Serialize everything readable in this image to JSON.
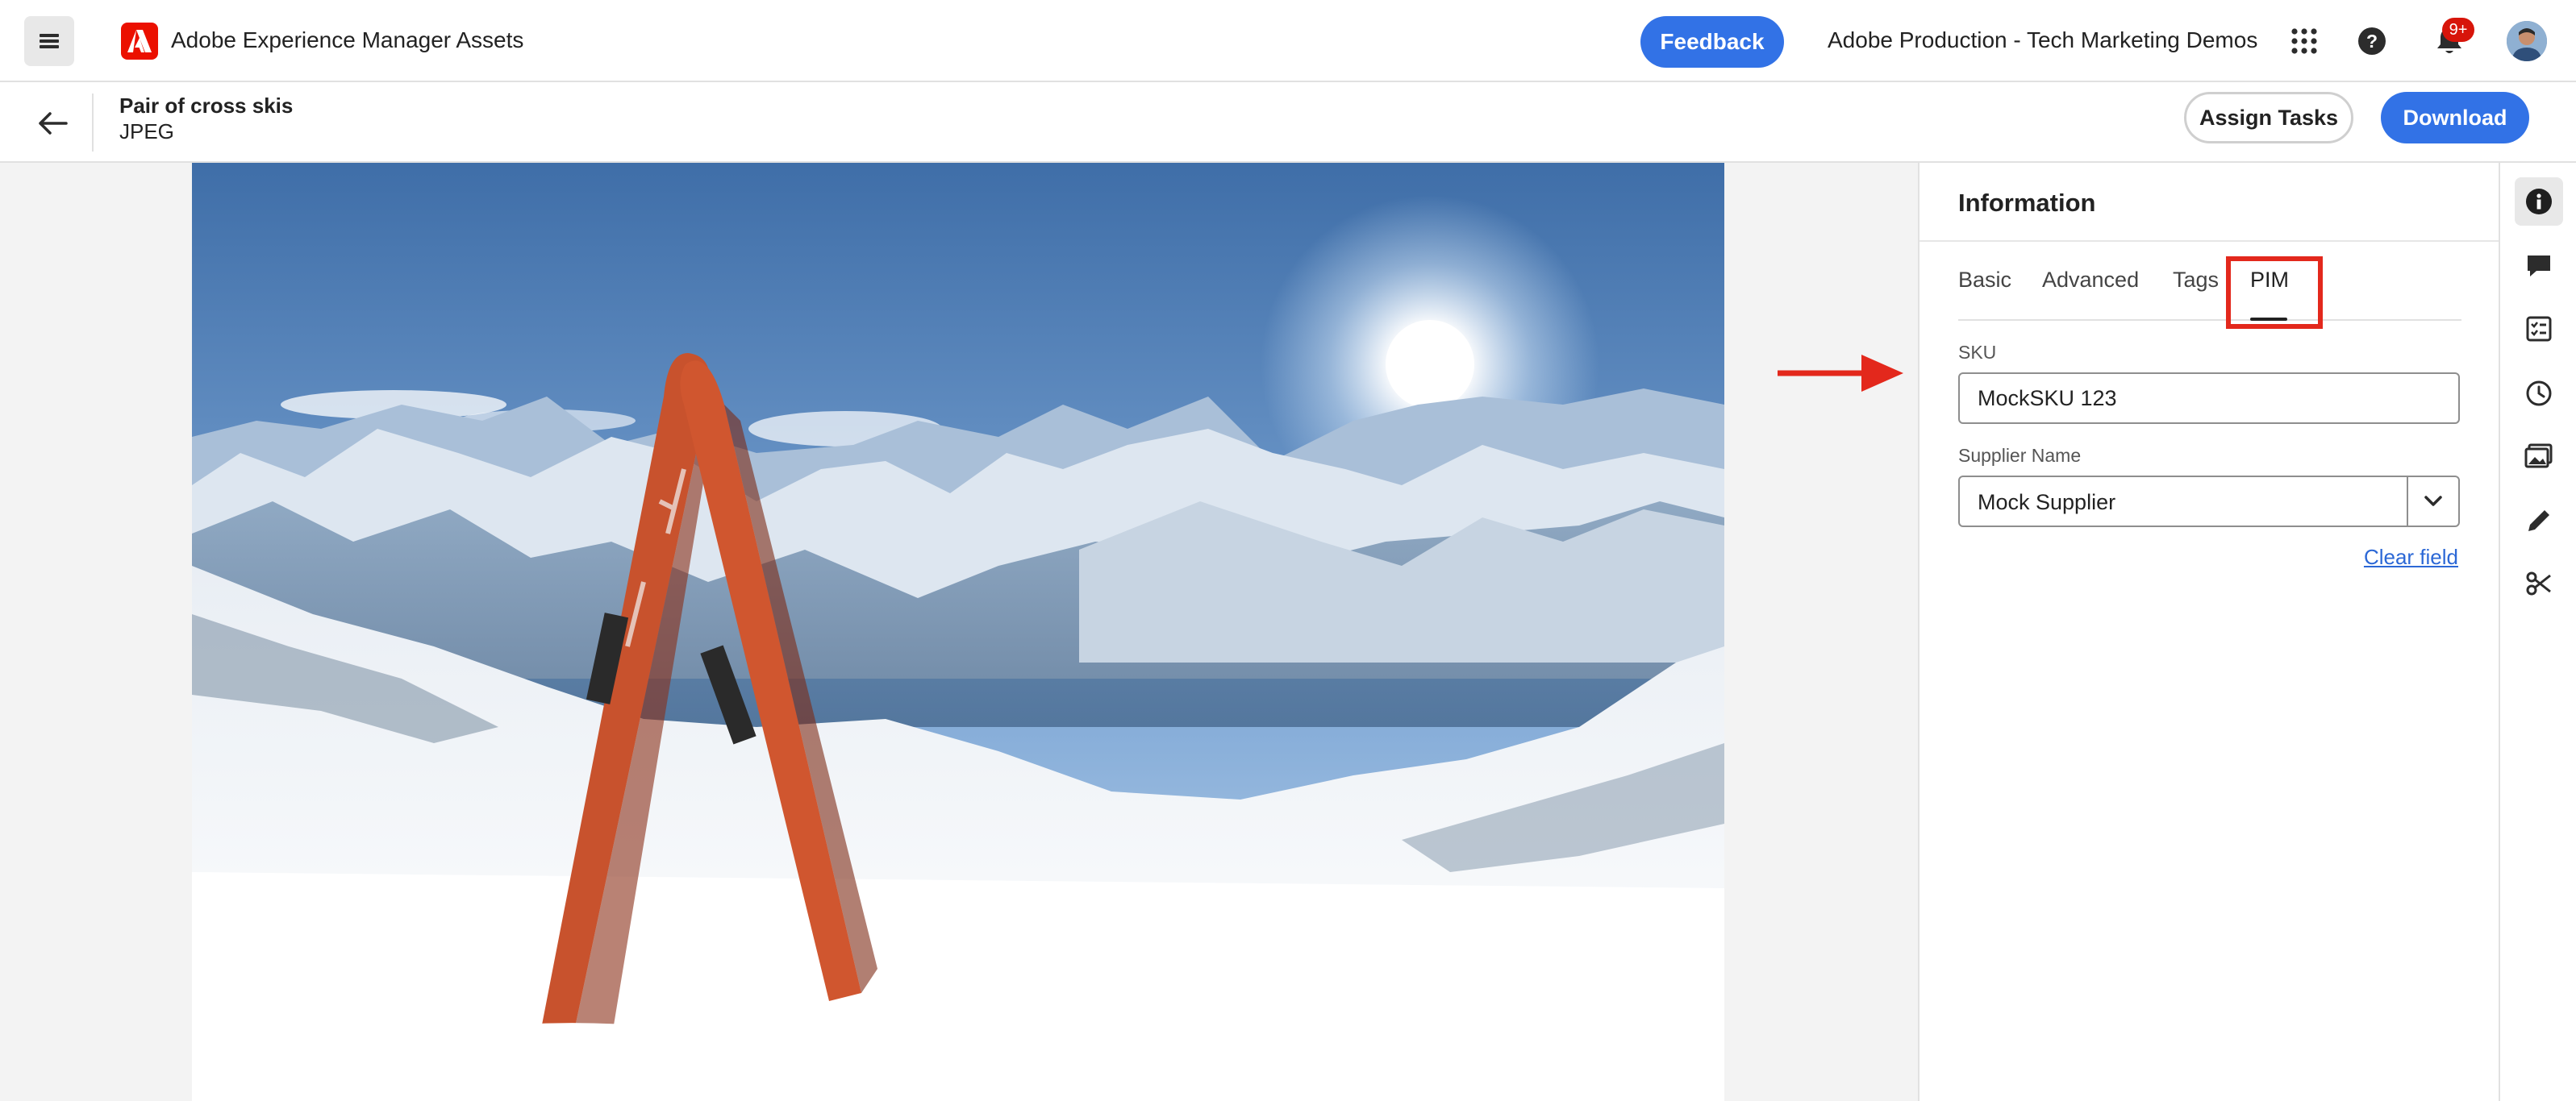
{
  "app": {
    "title": "Adobe Experience Manager Assets",
    "org": "Adobe Production - Tech Marketing Demos",
    "notifications_badge": "9+"
  },
  "topbar": {
    "feedback_label": "Feedback"
  },
  "asset": {
    "name": "Pair of cross skis",
    "type": "JPEG"
  },
  "actions": {
    "assign_tasks": "Assign Tasks",
    "download": "Download"
  },
  "panel": {
    "title": "Information",
    "tabs": [
      {
        "label": "Basic"
      },
      {
        "label": "Advanced"
      },
      {
        "label": "Tags"
      },
      {
        "label": "PIM",
        "active": true
      }
    ],
    "fields": {
      "sku": {
        "label": "SKU",
        "value": "MockSKU 123"
      },
      "supplier": {
        "label": "Supplier Name",
        "value": "Mock Supplier"
      }
    },
    "clear_field": "Clear field"
  },
  "rail_icons": [
    "info-icon",
    "comment-icon",
    "tasks-icon",
    "history-icon",
    "renditions-icon",
    "edit-icon",
    "crop-icon"
  ],
  "colors": {
    "accent": "#3272e6",
    "brand_red": "#eb1000",
    "annotation_red": "#e3281c"
  }
}
